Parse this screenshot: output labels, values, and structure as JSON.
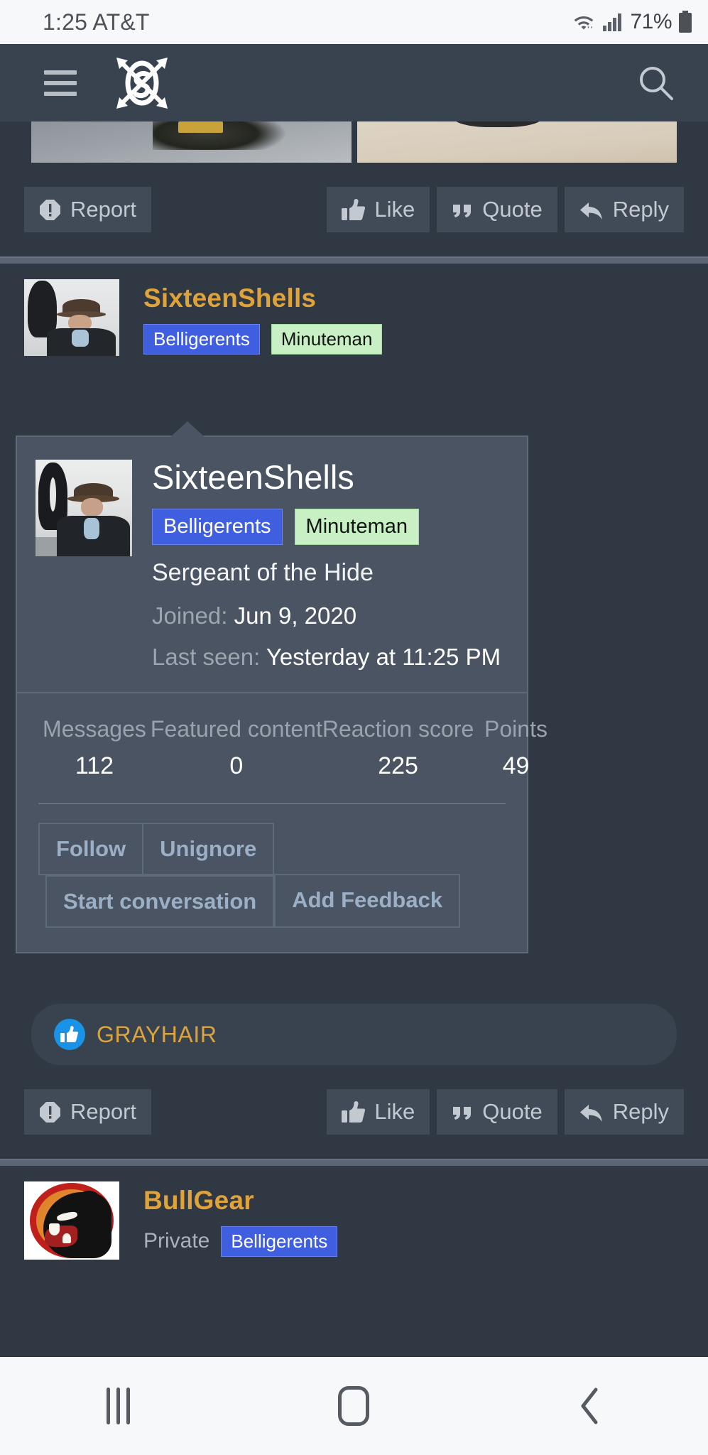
{
  "status_bar": {
    "time": "1:25",
    "carrier": "AT&T",
    "time_carrier": "1:25 AT&T",
    "battery_percent": "71%",
    "icons": [
      "wifi-icon",
      "cellular-signal-icon",
      "battery-icon"
    ]
  },
  "app_header": {
    "menu_icon": "hamburger-menu-icon",
    "logo_icon": "site-logo-icon",
    "search_icon": "search-icon"
  },
  "post_actions": {
    "report_label": "Report",
    "like_label": "Like",
    "quote_label": "Quote",
    "reply_label": "Reply"
  },
  "post_top": {
    "username": "SixteenShells",
    "badges": [
      "Belligerents",
      "Minuteman"
    ]
  },
  "popup": {
    "username": "SixteenShells",
    "badges": [
      {
        "label": "Belligerents",
        "style": "blue"
      },
      {
        "label": "Minuteman",
        "style": "green"
      }
    ],
    "title": "Sergeant of the Hide",
    "joined_label": "Joined:",
    "joined_value": "Jun 9, 2020",
    "last_seen_label": "Last seen:",
    "last_seen_value": "Yesterday at 11:25 PM",
    "stats": [
      {
        "label": "Messages",
        "value": "112"
      },
      {
        "label": "Featured content",
        "value": "0"
      },
      {
        "label": "Reaction score",
        "value": "225"
      },
      {
        "label": "Points",
        "value": "49"
      }
    ],
    "buttons": [
      "Follow",
      "Unignore",
      "Start conversation",
      "Add Feedback"
    ]
  },
  "reaction": {
    "icon": "thumbs-up-icon",
    "label": "GRAYHAIR"
  },
  "post_bottom": {
    "username": "BullGear",
    "privacy": "Private",
    "badge": "Belligerents"
  },
  "nav_bar": {
    "recents_icon": "recents-icon",
    "home_icon": "home-icon",
    "back_icon": "back-icon"
  },
  "colors": {
    "page_bg": "#2f3843",
    "header_bg": "#39424f",
    "popup_bg": "#4a5462",
    "username_orange": "#e0a33a",
    "badge_blue": "#3f5ee0",
    "badge_green": "#c8f0c4",
    "reaction_blue": "#1893e8",
    "button_text": "#9bb0c6"
  }
}
